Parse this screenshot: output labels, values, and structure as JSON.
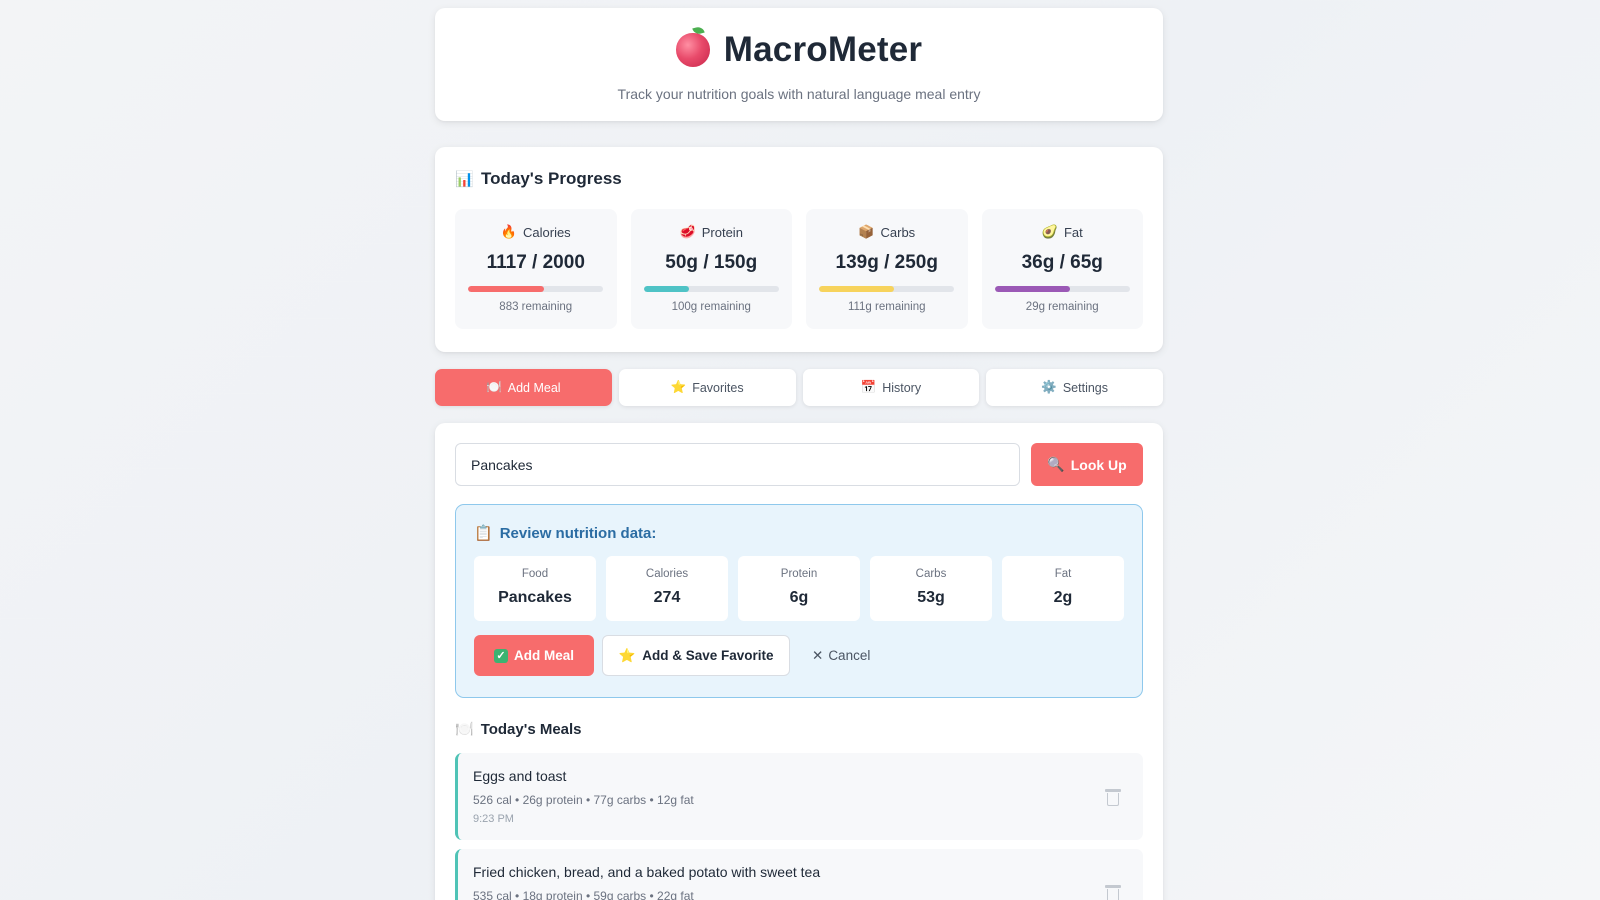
{
  "app": {
    "title": "MacroMeter",
    "subtitle": "Track your nutrition goals with natural language meal entry",
    "logo_icon": "apple-icon"
  },
  "progress": {
    "title": "Today's Progress",
    "icon": "bar-chart-icon",
    "stats": [
      {
        "label": "Calories",
        "icon": "fire-icon",
        "value": "1117 / 2000",
        "remaining": "883 remaining",
        "fraction": 0.5585,
        "color": "#f76c6c"
      },
      {
        "label": "Protein",
        "icon": "meat-icon",
        "value": "50g / 150g",
        "remaining": "100g remaining",
        "fraction": 0.333,
        "color": "#4fc3c6"
      },
      {
        "label": "Carbs",
        "icon": "box-icon",
        "value": "139g / 250g",
        "remaining": "111g remaining",
        "fraction": 0.556,
        "color": "#f7d35c"
      },
      {
        "label": "Fat",
        "icon": "avocado-icon",
        "value": "36g / 65g",
        "remaining": "29g remaining",
        "fraction": 0.554,
        "color": "#9b59b6"
      }
    ]
  },
  "tabs": [
    {
      "label": "Add Meal",
      "icon": "plate-icon",
      "active": true
    },
    {
      "label": "Favorites",
      "icon": "star-icon",
      "active": false
    },
    {
      "label": "History",
      "icon": "calendar-icon",
      "active": false
    },
    {
      "label": "Settings",
      "icon": "gear-icon",
      "active": false
    }
  ],
  "search": {
    "value": "Pancakes",
    "button_label": "Look Up",
    "button_icon": "magnifier-icon"
  },
  "review": {
    "title": "Review nutrition data:",
    "icon": "clipboard-icon",
    "fields": [
      {
        "label": "Food",
        "value": "Pancakes"
      },
      {
        "label": "Calories",
        "value": "274"
      },
      {
        "label": "Protein",
        "value": "6g"
      },
      {
        "label": "Carbs",
        "value": "53g"
      },
      {
        "label": "Fat",
        "value": "2g"
      }
    ],
    "add_label": "Add Meal",
    "fav_label": "Add & Save Favorite",
    "cancel_label": "Cancel"
  },
  "meals": {
    "title": "Today's Meals",
    "icon": "fork-knife-icon",
    "items": [
      {
        "name": "Eggs and toast",
        "macros": "526 cal • 26g protein • 77g carbs • 12g fat",
        "time": "9:23 PM"
      },
      {
        "name": "Fried chicken, bread, and a baked potato with sweet tea",
        "macros": "535 cal • 18g protein • 59g carbs • 22g fat",
        "time": ""
      }
    ]
  },
  "colors": {
    "accent": "#f76c6c",
    "review_bg": "#e8f4fc",
    "review_border": "#8ec8ec",
    "meal_border": "#4fc3b6"
  }
}
